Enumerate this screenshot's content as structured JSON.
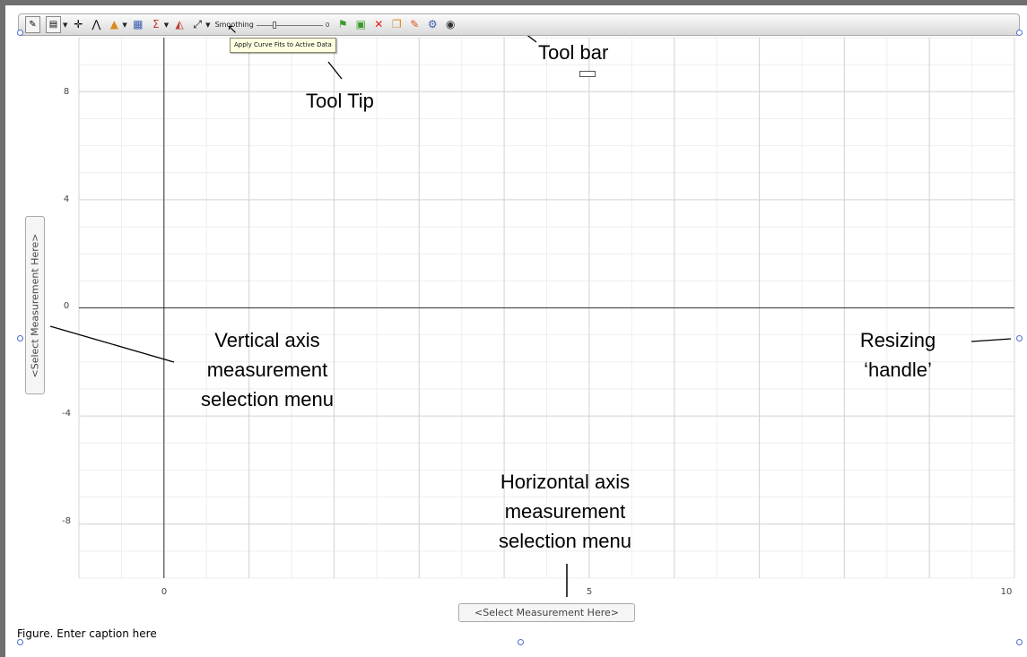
{
  "toolbar": {
    "buttons": [
      {
        "name": "edit-graph-icon",
        "glyph": "✎"
      },
      {
        "name": "display-mode-icon",
        "glyph": "▤"
      },
      {
        "name": "move-crosshair-icon",
        "glyph": "✛"
      },
      {
        "name": "curve-tool-icon",
        "glyph": "⋀"
      },
      {
        "name": "shape-tool-icon",
        "glyph": "▲"
      },
      {
        "name": "grid-select-icon",
        "glyph": "▦"
      },
      {
        "name": "sum-icon",
        "glyph": "Σ"
      },
      {
        "name": "area-icon",
        "glyph": "◭"
      },
      {
        "name": "curve-fit-icon",
        "glyph": "⤢"
      }
    ],
    "smoothing_label": "Smoothing",
    "smoothing_value": "0",
    "right_buttons": [
      {
        "name": "add-marker-icon",
        "glyph": "⚑"
      },
      {
        "name": "select-data-icon",
        "glyph": "▣"
      },
      {
        "name": "delete-icon",
        "glyph": "✕"
      },
      {
        "name": "copy-icon",
        "glyph": "❐"
      },
      {
        "name": "pin-icon",
        "glyph": "✎"
      },
      {
        "name": "settings-gear-icon",
        "glyph": "⚙"
      },
      {
        "name": "visibility-eye-icon",
        "glyph": "◉"
      }
    ]
  },
  "tooltip": "Apply Curve Fits to Active Data",
  "chart_data": {
    "type": "scatter",
    "series": [],
    "xlim": [
      -1,
      10
    ],
    "ylim": [
      -10,
      10
    ],
    "x_ticks": [
      0,
      5,
      10
    ],
    "y_ticks": [
      8,
      4,
      0,
      -4,
      -8
    ],
    "x_tick_labels": [
      "0",
      "5",
      "10"
    ],
    "y_tick_labels": [
      "8",
      "4",
      "0",
      "-4",
      "-8"
    ],
    "grid": true,
    "xlabel": "<Select Measurement Here>",
    "ylabel": "<Select Measurement Here>"
  },
  "axis_menus": {
    "vertical": "<Select Measurement Here>",
    "horizontal": "<Select Measurement Here>"
  },
  "caption": "Figure. Enter caption here",
  "annotations": {
    "tool_bar": "Tool bar",
    "tool_tip": "Tool Tip",
    "vertical_menu": [
      "Vertical axis",
      "measurement",
      "selection menu"
    ],
    "resizing_handle": [
      "Resizing",
      "‘handle’"
    ],
    "horizontal_menu": [
      "Horizontal axis",
      "measurement",
      "selection menu"
    ]
  },
  "colors": {
    "frame": "#6f6f6f",
    "grid_minor": "#eeeeee",
    "grid_major": "#d4d4d4",
    "zero_axis": "#333333",
    "delete_red": "#e01a1a",
    "green_icon": "#3a9a2a",
    "handle_blue": "#4a6ed6"
  }
}
